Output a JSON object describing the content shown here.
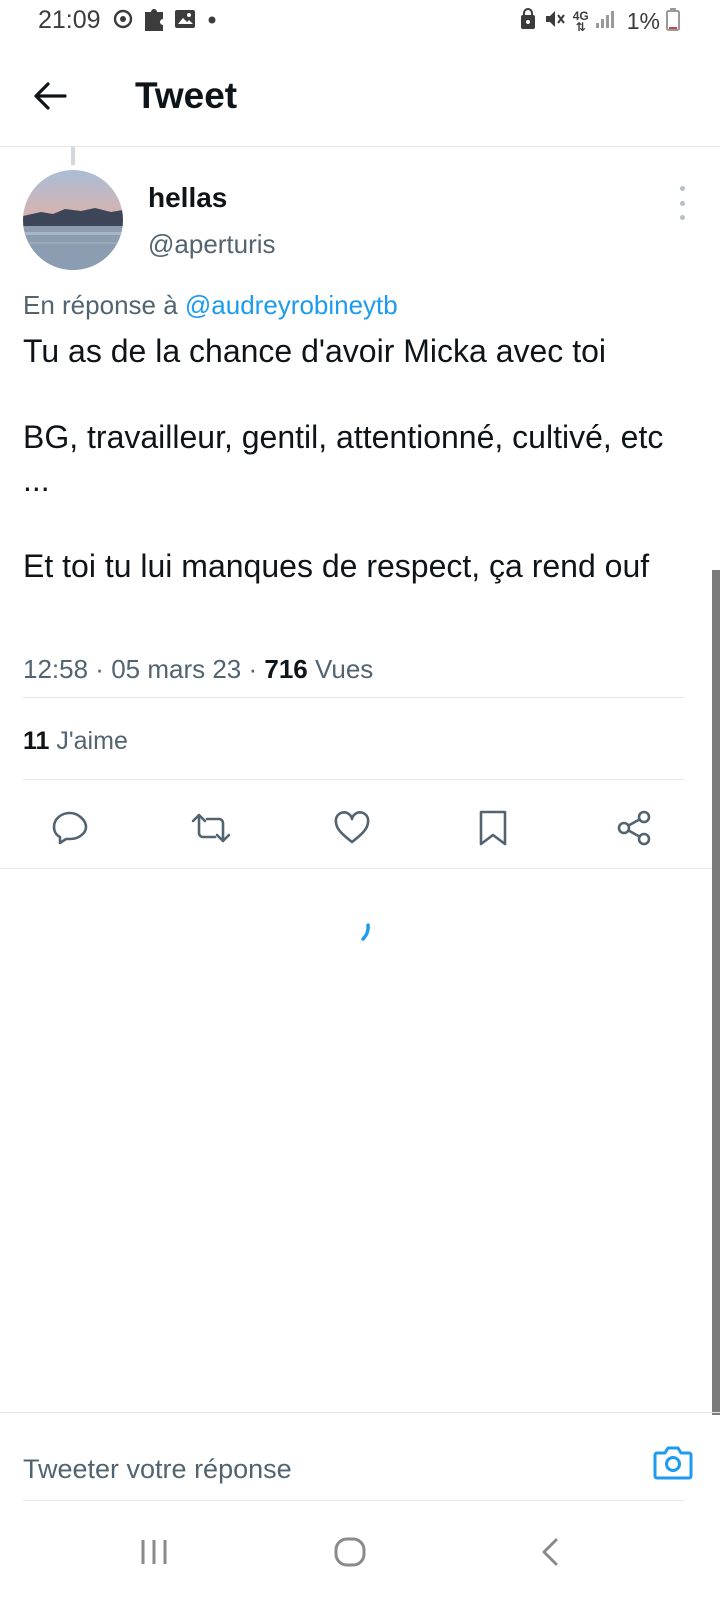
{
  "status_bar": {
    "time": "21:09",
    "network": "4G",
    "battery_percent": "1%",
    "icons_left": [
      "sync-icon",
      "puzzle-icon",
      "image-icon",
      "dot-icon"
    ],
    "icons_right": [
      "lock-icon",
      "mute-icon",
      "network-4g-icon",
      "signal-icon",
      "battery-icon"
    ]
  },
  "header": {
    "title": "Tweet",
    "back_icon": "arrow-left-icon"
  },
  "tweet": {
    "author_name": "hellas",
    "author_handle": "@aperturis",
    "reply_prefix": "En réponse à ",
    "reply_mention": "@audreyrobineytb",
    "text_paragraphs": [
      "Tu as de la chance d'avoir Micka avec toi",
      "BG, travailleur, gentil, attentionné, cultivé, etc ...",
      "Et toi tu lui manques de respect, ça rend ouf"
    ],
    "time": "12:58",
    "separator": " · ",
    "date": "05 mars 23",
    "views_count": "716",
    "views_label": " Vues",
    "likes_count": "11",
    "likes_label": " J'aime"
  },
  "actions": [
    {
      "name": "reply-button",
      "icon": "comment-icon"
    },
    {
      "name": "retweet-button",
      "icon": "retweet-icon"
    },
    {
      "name": "like-button",
      "icon": "heart-icon"
    },
    {
      "name": "bookmark-button",
      "icon": "bookmark-icon"
    },
    {
      "name": "share-button",
      "icon": "share-icon"
    }
  ],
  "reply": {
    "placeholder": "Tweeter votre réponse",
    "camera_icon": "camera-icon"
  },
  "navigation": [
    "recents-icon",
    "home-icon",
    "back-icon"
  ],
  "colors": {
    "accent": "#1d9bf0",
    "text_primary": "#0f1419",
    "text_secondary": "#536471",
    "divider": "#e6e9eb"
  }
}
